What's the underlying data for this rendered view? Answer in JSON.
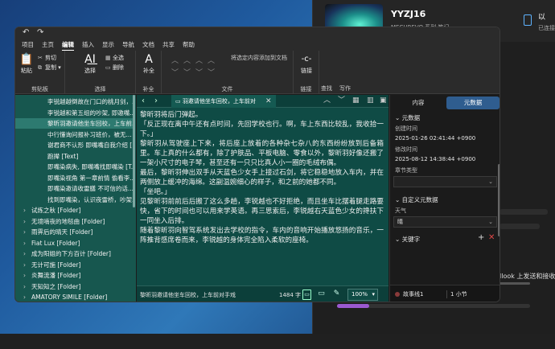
{
  "background_window": {
    "device_name": "YYZJ16",
    "device_sub": "MECHREVO 系列 笔记",
    "right_title": "以 ",
    "right_sub": "已连接",
    "outlook_text": "llook 上发送和接收"
  },
  "titlebar": {
    "undo_icon": "undo-icon",
    "redo_icon": "redo-icon"
  },
  "ribbon_tabs": [
    "项目",
    "主页",
    "编辑",
    "插入",
    "显示",
    "导航",
    "文档",
    "共享",
    "帮助"
  ],
  "ribbon_active_tab": "编辑",
  "ribbon": {
    "clipboard": {
      "paste": "粘贴",
      "cut": "剪切",
      "copy": "复制",
      "label": "剪贴板"
    },
    "select": {
      "select": "选择",
      "select_all": "全选",
      "delete": "删除",
      "label": "选择"
    },
    "completion": {
      "completion": "补全",
      "label": "补全"
    },
    "file": {
      "move_to_doc": "将选定内容添加到文档",
      "label": "文件"
    },
    "link": {
      "link": "链接",
      "label": "链接"
    },
    "find": {
      "label": "查找"
    },
    "write": {
      "label": "写作"
    }
  },
  "tree": {
    "items": [
      {
        "label": "李锐越越倒故在门口的桃月剑，...",
        "indent": 3,
        "selected": false,
        "expander": ""
      },
      {
        "label": "李锐越和第五组的吵架, 即邀嘴...",
        "indent": 3,
        "selected": false,
        "expander": ""
      },
      {
        "label": "黎昕羽邀请他坐车回校，上车前...",
        "indent": 3,
        "selected": true,
        "expander": ""
      },
      {
        "label": "中行懂询问报补习班价，被无...",
        "indent": 3,
        "selected": false,
        "expander": ""
      },
      {
        "label": "谢君商不认形 即嘴嘴自我介绍 [...",
        "indent": 3,
        "selected": false,
        "expander": ""
      },
      {
        "label": "跑撵 [Text]",
        "indent": 3,
        "selected": false,
        "expander": ""
      },
      {
        "label": "即嘴染病失, 即嘴嘴找即嘴染 [T...",
        "indent": 3,
        "selected": false,
        "expander": ""
      },
      {
        "label": "即嘴染视角 第一章前情 偷看李...",
        "indent": 3,
        "selected": false,
        "expander": ""
      },
      {
        "label": "即嘴染邀请收雷膳 不可信的话...",
        "indent": 3,
        "selected": false,
        "expander": ""
      },
      {
        "label": "找到即嘴染，认识夜雷桥，吵架...",
        "indent": 3,
        "selected": false,
        "expander": ""
      },
      {
        "label": "试炼之秋 [Folder]",
        "indent": 1,
        "selected": false,
        "expander": "›"
      },
      {
        "label": "无境喃夜的地毯曲 [Folder]",
        "indent": 1,
        "selected": false,
        "expander": "›"
      },
      {
        "label": "雨霁后的晴天 [Folder]",
        "indent": 1,
        "selected": false,
        "expander": "›"
      },
      {
        "label": "Fiat Lux [Folder]",
        "indent": 1,
        "selected": false,
        "expander": "›"
      },
      {
        "label": "成为阳姐的下方百计 [Folder]",
        "indent": 1,
        "selected": false,
        "expander": "›"
      },
      {
        "label": "无计可施 [Folder]",
        "indent": 1,
        "selected": false,
        "expander": "›"
      },
      {
        "label": "炎舞流潘 [Folder]",
        "indent": 1,
        "selected": false,
        "expander": "›"
      },
      {
        "label": "天知知之 [Folder]",
        "indent": 1,
        "selected": false,
        "expander": "›"
      },
      {
        "label": "AMATORY SIMILE [Folder]",
        "indent": 1,
        "selected": false,
        "expander": "›"
      }
    ]
  },
  "editor": {
    "tab_title": "羽邀请他坐车回校，上车前对",
    "paragraphs": [
      "黎昕羽将后门弹起。",
      "「反正现在离中午还有点时间，先回学校也行。啊，车上东西比较乱，我收拾一下。」",
      "黎昕羽从驾驶座上下来，将后座上放着的各种杂七杂八的东西纷纷放到后备箱里。车上真的什么都有，除了护肤品、平板电脑、零食以外，黎昕羽好像还搬了一架小尺寸的电子琴，甚至还有一只只比真人小一圈的毛绒布偶。",
      "最后，黎昕羽伸出双手从天蓝色少女手上接过石剑，将它稳稳地放入车内，并在两侧放上缓冲的海绵。这副温婉细心的样子，和之前的她都不同。",
      "「坐吧。」",
      "见黎昕羽前前后后搬了这么多趟，李锐越也不好拒绝，而且坐车比摆着腿走路要快，省下的时间也可以用来学英语。再三思索后，李锐越右天蓝色少女的搀扶下一同坐入后排。",
      "随着黎昕羽向智驾系统发出去学校的指令，车内的音响开始播放悠扬的音乐，一阵推背感席卷而来，李锐越的身体完全陷入柔软的座椅。"
    ],
    "status_title": "黎昕羽邀请他坐车回校，上车前对手戏",
    "word_count": "1484 字",
    "zoom": "100%"
  },
  "inspector": {
    "tabs": [
      "内容",
      "元数据"
    ],
    "active_tab": "元数据",
    "metadata_section": "元数据",
    "created_label": "创建时间",
    "created_value": "2025-01-26 02:41:44 +0900",
    "modified_label": "修改时间",
    "modified_value": "2025-08-12 14:38:44 +0900",
    "chapter_type_label": "章节类型",
    "chapter_type_value": "",
    "custom_section": "自定义元数据",
    "weather_label": "天气",
    "weather_value": "晴",
    "keywords_section": "关键字",
    "footer_story": "故事线1",
    "footer_section": "1 小节"
  },
  "colors": {
    "tree_bg": "#17574f",
    "editor_bg": "#0f4b45",
    "accent": "#2f5d8f"
  }
}
